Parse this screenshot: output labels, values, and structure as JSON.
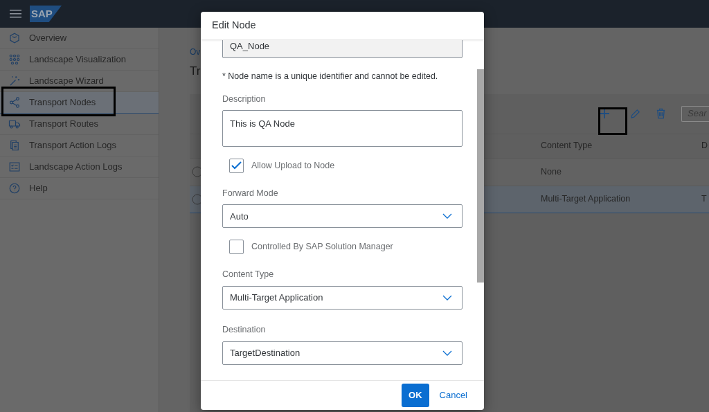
{
  "shell": {
    "logo": "SAP"
  },
  "sidebar": {
    "items": [
      {
        "label": "Overview",
        "selected": false
      },
      {
        "label": "Landscape Visualization",
        "selected": false
      },
      {
        "label": "Landscape Wizard",
        "selected": false
      },
      {
        "label": "Transport Nodes",
        "selected": true
      },
      {
        "label": "Transport Routes",
        "selected": false
      },
      {
        "label": "Transport Action Logs",
        "selected": false
      },
      {
        "label": "Landscape Action Logs",
        "selected": false
      },
      {
        "label": "Help",
        "selected": false
      }
    ]
  },
  "page": {
    "breadcrumb": "Ov",
    "title": "Tr",
    "search": {
      "placeholder": "Sear"
    },
    "table": {
      "columns": [
        "Content Type",
        "D"
      ],
      "rows": [
        {
          "cells": [
            "None",
            ""
          ],
          "selected": false
        },
        {
          "cells": [
            "Multi-Target Application",
            "T"
          ],
          "selected": true
        }
      ]
    }
  },
  "dialog": {
    "title": "Edit Node",
    "fields": [
      {
        "kind": "readonly",
        "value": "QA_Node"
      },
      {
        "kind": "note",
        "text": "* Node name is a unique identifier and cannot be edited."
      },
      {
        "kind": "textarea",
        "label": "Description",
        "value": "This is QA Node"
      },
      {
        "kind": "checkbox",
        "label": "Allow Upload to Node",
        "checked": true
      },
      {
        "kind": "select",
        "label": "Forward Mode",
        "value": "Auto"
      },
      {
        "kind": "checkbox",
        "label": "Controlled By SAP Solution Manager",
        "checked": false
      },
      {
        "kind": "select",
        "label": "Content Type",
        "value": "Multi-Target Application"
      },
      {
        "kind": "select",
        "label": "Destination",
        "value": "TargetDestination"
      }
    ],
    "buttons": [
      {
        "label": "OK",
        "kind": "primary"
      },
      {
        "label": "Cancel",
        "kind": "link"
      }
    ]
  }
}
